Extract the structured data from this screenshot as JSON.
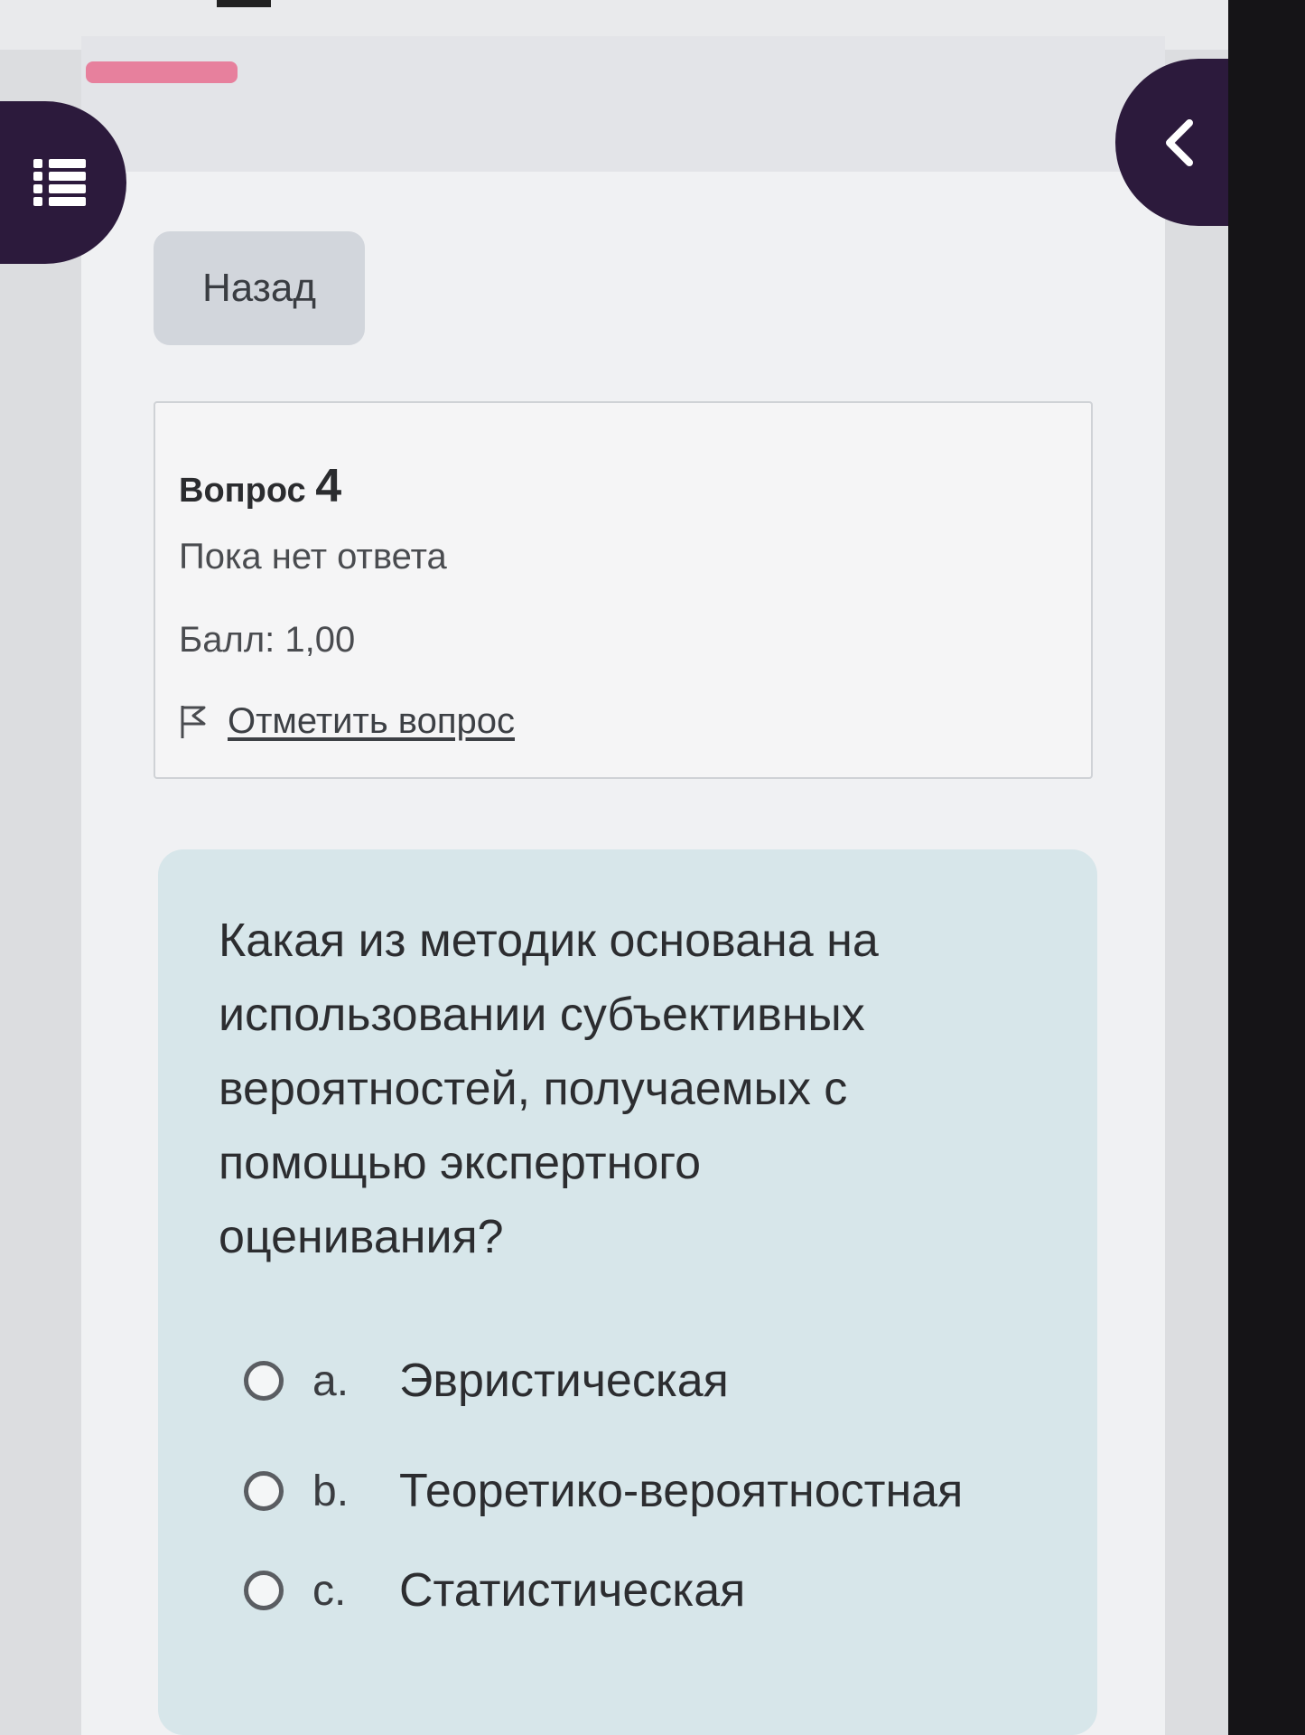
{
  "header": {
    "back_label": "Назад"
  },
  "question_info": {
    "title_prefix": "Вопрос",
    "number": "4",
    "status": "Пока нет ответа",
    "score": "Балл: 1,00",
    "flag_label": "Отметить вопрос"
  },
  "question": {
    "text": "Какая из методик основана на использовании субъективных вероятностей, получаемых с помощью экспертного оценивания?",
    "answers": [
      {
        "letter": "a.",
        "text": "Эвристическая"
      },
      {
        "letter": "b.",
        "text": "Теоретико-вероятностная"
      },
      {
        "letter": "c.",
        "text": "Статистическая"
      }
    ]
  },
  "icons": {
    "drawer_toggle": "list-icon",
    "block_toggle": "chevron-left-icon",
    "flag": "flag-icon"
  },
  "colors": {
    "accent_dark": "#2c1a3c",
    "progress_pink": "#e7809d",
    "question_bg": "#d7e6ea"
  }
}
